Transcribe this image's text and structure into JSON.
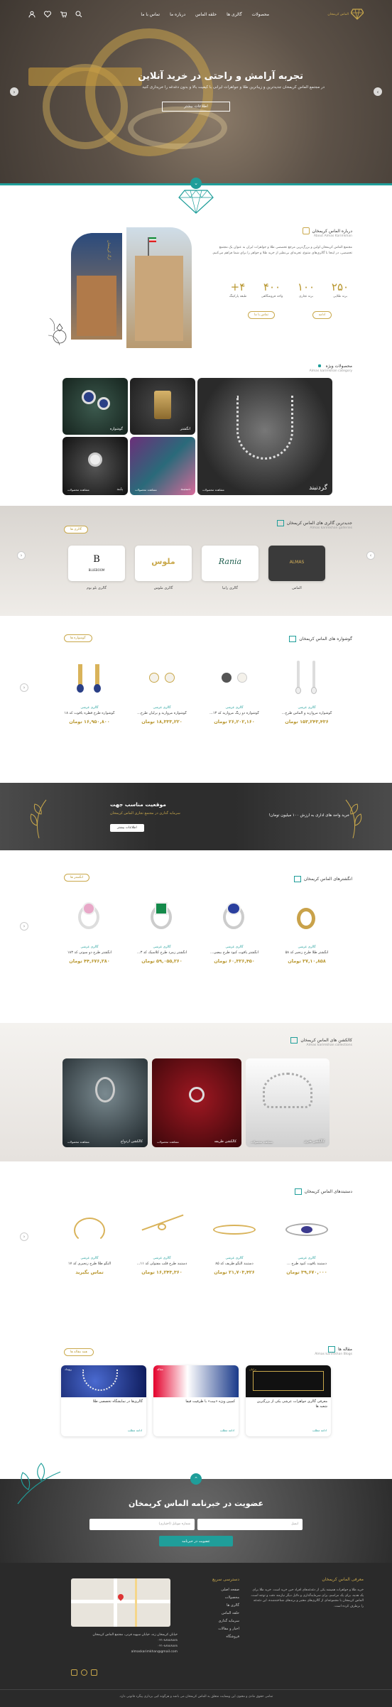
{
  "header": {
    "nav": [
      "محصولات",
      "گالری ها",
      "حلقه الماس",
      "درباره ما",
      "تماس با ما"
    ],
    "brand": "الماس کریمخان"
  },
  "hero": {
    "title": "تجربه آرامش و راحتی در خرید آنلاین",
    "subtitle": "در مجتمع الماس کریمخان جدیدترین و زیباترین طلا و جواهرات ایرانی با کیفیت بالا و بدون دغدغه را خریداری کنید",
    "button": "اطلاعات بیشتر"
  },
  "about": {
    "title": "درباره الماس کریمخان",
    "subtitle": "About Almas Karimkhan",
    "text": "مجتمع الماس کریمخان اولین و بزرگ‌ترین مرجع تخصصی طلا و جواهرات ایران به عنوان یک مجتمع تخصصی، در اینجا با گالری‌های متنوع، تجربه‌ای بی‌نظیر از خرید طلا و جواهر را برای شما فراهم می‌کنیم.",
    "stats": [
      {
        "value": "۲۵۰",
        "label": "برند طلایی"
      },
      {
        "value": "۱۰۰",
        "label": "برند تجاری"
      },
      {
        "value": "۴۰۰",
        "label": "واحد فروشگاهی"
      },
      {
        "value": "۴+",
        "label": "طبقه پارکینگ"
      }
    ],
    "btn_more": "ادامه",
    "btn_contact": "تماس با ما",
    "vertical_label": "ارگ کریمخان"
  },
  "categories": {
    "title": "محصولات ویژه",
    "subtitle": "Almas karimkhan category",
    "items": [
      {
        "name": "گردنبند",
        "more": "مشاهده محصولات"
      },
      {
        "name": "انگشتر",
        "more": ""
      },
      {
        "name": "گوشواره",
        "more": ""
      },
      {
        "name": "دستبند",
        "more": "مشاهده محصولات"
      },
      {
        "name": "پابند",
        "more": "مشاهده محصولات"
      }
    ]
  },
  "galleries": {
    "title": "جدیدترین گالری های الماس کریمخان",
    "subtitle": "Almas karimkhan galleries",
    "button": "گالری ها",
    "items": [
      {
        "name": "الماس",
        "logo": "ALMAS"
      },
      {
        "name": "گالری رانیا",
        "logo": "Rania"
      },
      {
        "name": "گالری ملوس",
        "logo": "ملوس"
      },
      {
        "name": "گالری بلو بوم",
        "logo": "BLUEBOOM"
      }
    ]
  },
  "earrings": {
    "title": "گوشواره های الماس کریمخان",
    "button": "گوشواره ها",
    "items": [
      {
        "brand": "گالری عرشی",
        "name": "گوشواره مروارید و الماس طرح...",
        "price": "۱۵۳,۲۴۳,۴۳۶ تومان"
      },
      {
        "brand": "گالری عرشی",
        "name": "گوشواره دو رنگ مروارید کد ۱۳...",
        "price": "۲۶,۲۰۲,۱۶۰ تومان"
      },
      {
        "brand": "گالری عرشی",
        "name": "گوشواره مروارید و برلیان طرح...",
        "price": "۱۸,۳۳۳,۲۲۰ تومان"
      },
      {
        "brand": "گالری عرشی",
        "name": "گوشواره طرح قطره یاقوت کد ۱۸",
        "price": "۱۶,۹۵۰,۸۰۰ تومان"
      }
    ]
  },
  "banner": {
    "title": "موقعیت مناسب جهت",
    "subtitle": "سرمایه گذاری در مجتمع تجاری الماس کریمخان",
    "text": "خرید واحد های اداری به ارزش ۱۰۰ میلیون تومان!",
    "button": "اطلاعات بیشتر"
  },
  "rings": {
    "title": "انگشترهای الماس کریمخان",
    "button": "انگشتر ها",
    "items": [
      {
        "brand": "گالری عرشی",
        "name": "انگشتر طلا طرح زنجیر کد ۵۸",
        "price": "۳۷,۱۰,۸۵۸ تومان"
      },
      {
        "brand": "گالری عرشی",
        "name": "انگشتر یاقوت کبود طرح بیضی...",
        "price": "۶۰,۳۲۶,۴۵۰ تومان"
      },
      {
        "brand": "گالری عرشی",
        "name": "انگشتر زمرد طرح کلاسیک کد ۳...",
        "price": "۵۹,۰۵۵,۲۶۰ تومان"
      },
      {
        "brand": "گالری عرشی",
        "name": "انگشتر طرح دو سوتی کد ۱۸۳",
        "price": "۴۴,۶۷۶,۲۸۰ تومان"
      }
    ]
  },
  "collections": {
    "title": "کالکشن های الماس کریمخان",
    "subtitle": "Almas karimkhan collections",
    "items": [
      {
        "name": "کالکشن هنری",
        "more": "مشاهده محصولات"
      },
      {
        "name": "کالکشن ظریفه",
        "more": "مشاهده محصولات"
      },
      {
        "name": "کالکشن ازدواج",
        "more": "مشاهده محصولات"
      }
    ]
  },
  "bracelets": {
    "title": "دستبندهای الماس کریمخان",
    "items": [
      {
        "brand": "گالری عرشی",
        "name": "دستبند یاقوت کبود طرح ...",
        "price": "۳۹,۶۷۰,۰۰۰ تومان"
      },
      {
        "brand": "گالری عرشی",
        "name": "دستبند النگو ظریف کد ۸۵",
        "price": "۲۱,۷۰۳,۴۲۶ تومان"
      },
      {
        "brand": "گالری عرشی",
        "name": "دستبند طرح قلب مفتولی کد ۱۱...",
        "price": "۱۶,۲۴۳,۳۶۰ تومان"
      },
      {
        "brand": "گالری عرشی",
        "name": "النگو طلا طرح زنجیری کد ۱۷",
        "price": "تماس بگیرید"
      }
    ]
  },
  "blog": {
    "title": "مقاله ها",
    "subtitle": "Almas karimkhan Blogs",
    "button": "همه مقاله ها",
    "items": [
      {
        "title": "معرفی گالری جواهرات عرشی یکی از بزرگترین شعبه ها",
        "read": "ادامه مطلب",
        "tag": "برلیان"
      },
      {
        "title": "کمپین ویژه «بیت» با ظرفیت فیفا",
        "read": "ادامه مطلب",
        "tag": "مقاله"
      },
      {
        "title": "گالری‌ها در نمایشگاه تخصصی طلا",
        "read": "ادامه مطلب",
        "tag": "رویداد"
      }
    ]
  },
  "newsletter": {
    "title": "عضویت در خبرنامه الماس کریمخان",
    "email_placeholder": "ایمیل",
    "phone_placeholder": "شماره موبایل (اختیاری)",
    "button": "عضویت در خبرنامه"
  },
  "footer": {
    "about_title": "معرفی الماس کریمخان",
    "about_text": "خرید طلا و جواهرات همیشه یکی از دغدغه‌های افراد حین خرید است. خرید طلا برای یک هدیه، برای یک مراسم، برای سرمایه‌گذاری و دلایل دیگر نیازمند دقت و توجه است. الماس کریمخان با مجموعه‌ای از گالری‌های معتبر و برندهای شناخته‌شده، این دغدغه را برطرف کرده است.",
    "links_title": "دسترسی سریع",
    "links": [
      "صفحه اصلی",
      "محصولات",
      "گالری ها",
      "حلقه الماس",
      "سرمایه گذاری",
      "اخبار و مقالات",
      "فروشگاه"
    ],
    "address": "خیابان کریمخان زند، خیابان سپهبد قرنی، مجتمع الماس کریمخان",
    "phone1": "۰۲۱-۸۸۸۸۸۸۸۸",
    "phone2": "۰۲۱-۸۸۸۸۸۸۸۸",
    "email": "almaskarimkhan@gmail.com",
    "copyright": "تمامی حقوق مادی و معنوی این وبسایت متعلق به الماس کریمخان می باشد و هرگونه کپی برداری پیگرد قانونی دارد."
  }
}
